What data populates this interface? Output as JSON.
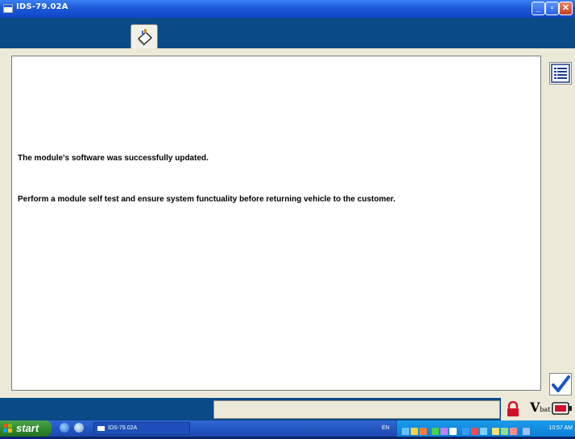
{
  "window": {
    "title": "IDS-79.02A"
  },
  "toolbar": {
    "active_tab_icon": "tool-book-icon"
  },
  "content": {
    "line1": "The module's software was successfully updated.",
    "line2": "Perform a module self test and ensure system functuality before returning vehicle to the customer."
  },
  "side_buttons": {
    "list_icon": "list-icon",
    "confirm_icon": "checkmark-icon"
  },
  "status_bar": {
    "field_value": "",
    "icons": [
      "lock-icon",
      "vehicle-battery-icon",
      "vci-icon"
    ]
  },
  "taskbar": {
    "start_label": "start",
    "task_item_label": "IDS-79.02A",
    "language": "EN",
    "clock": "10:57 AM"
  },
  "colors": {
    "app_blue": "#0a4a86",
    "panel": "#ece9d8",
    "check_blue": "#1a56c8",
    "lock_red": "#d0102a"
  }
}
